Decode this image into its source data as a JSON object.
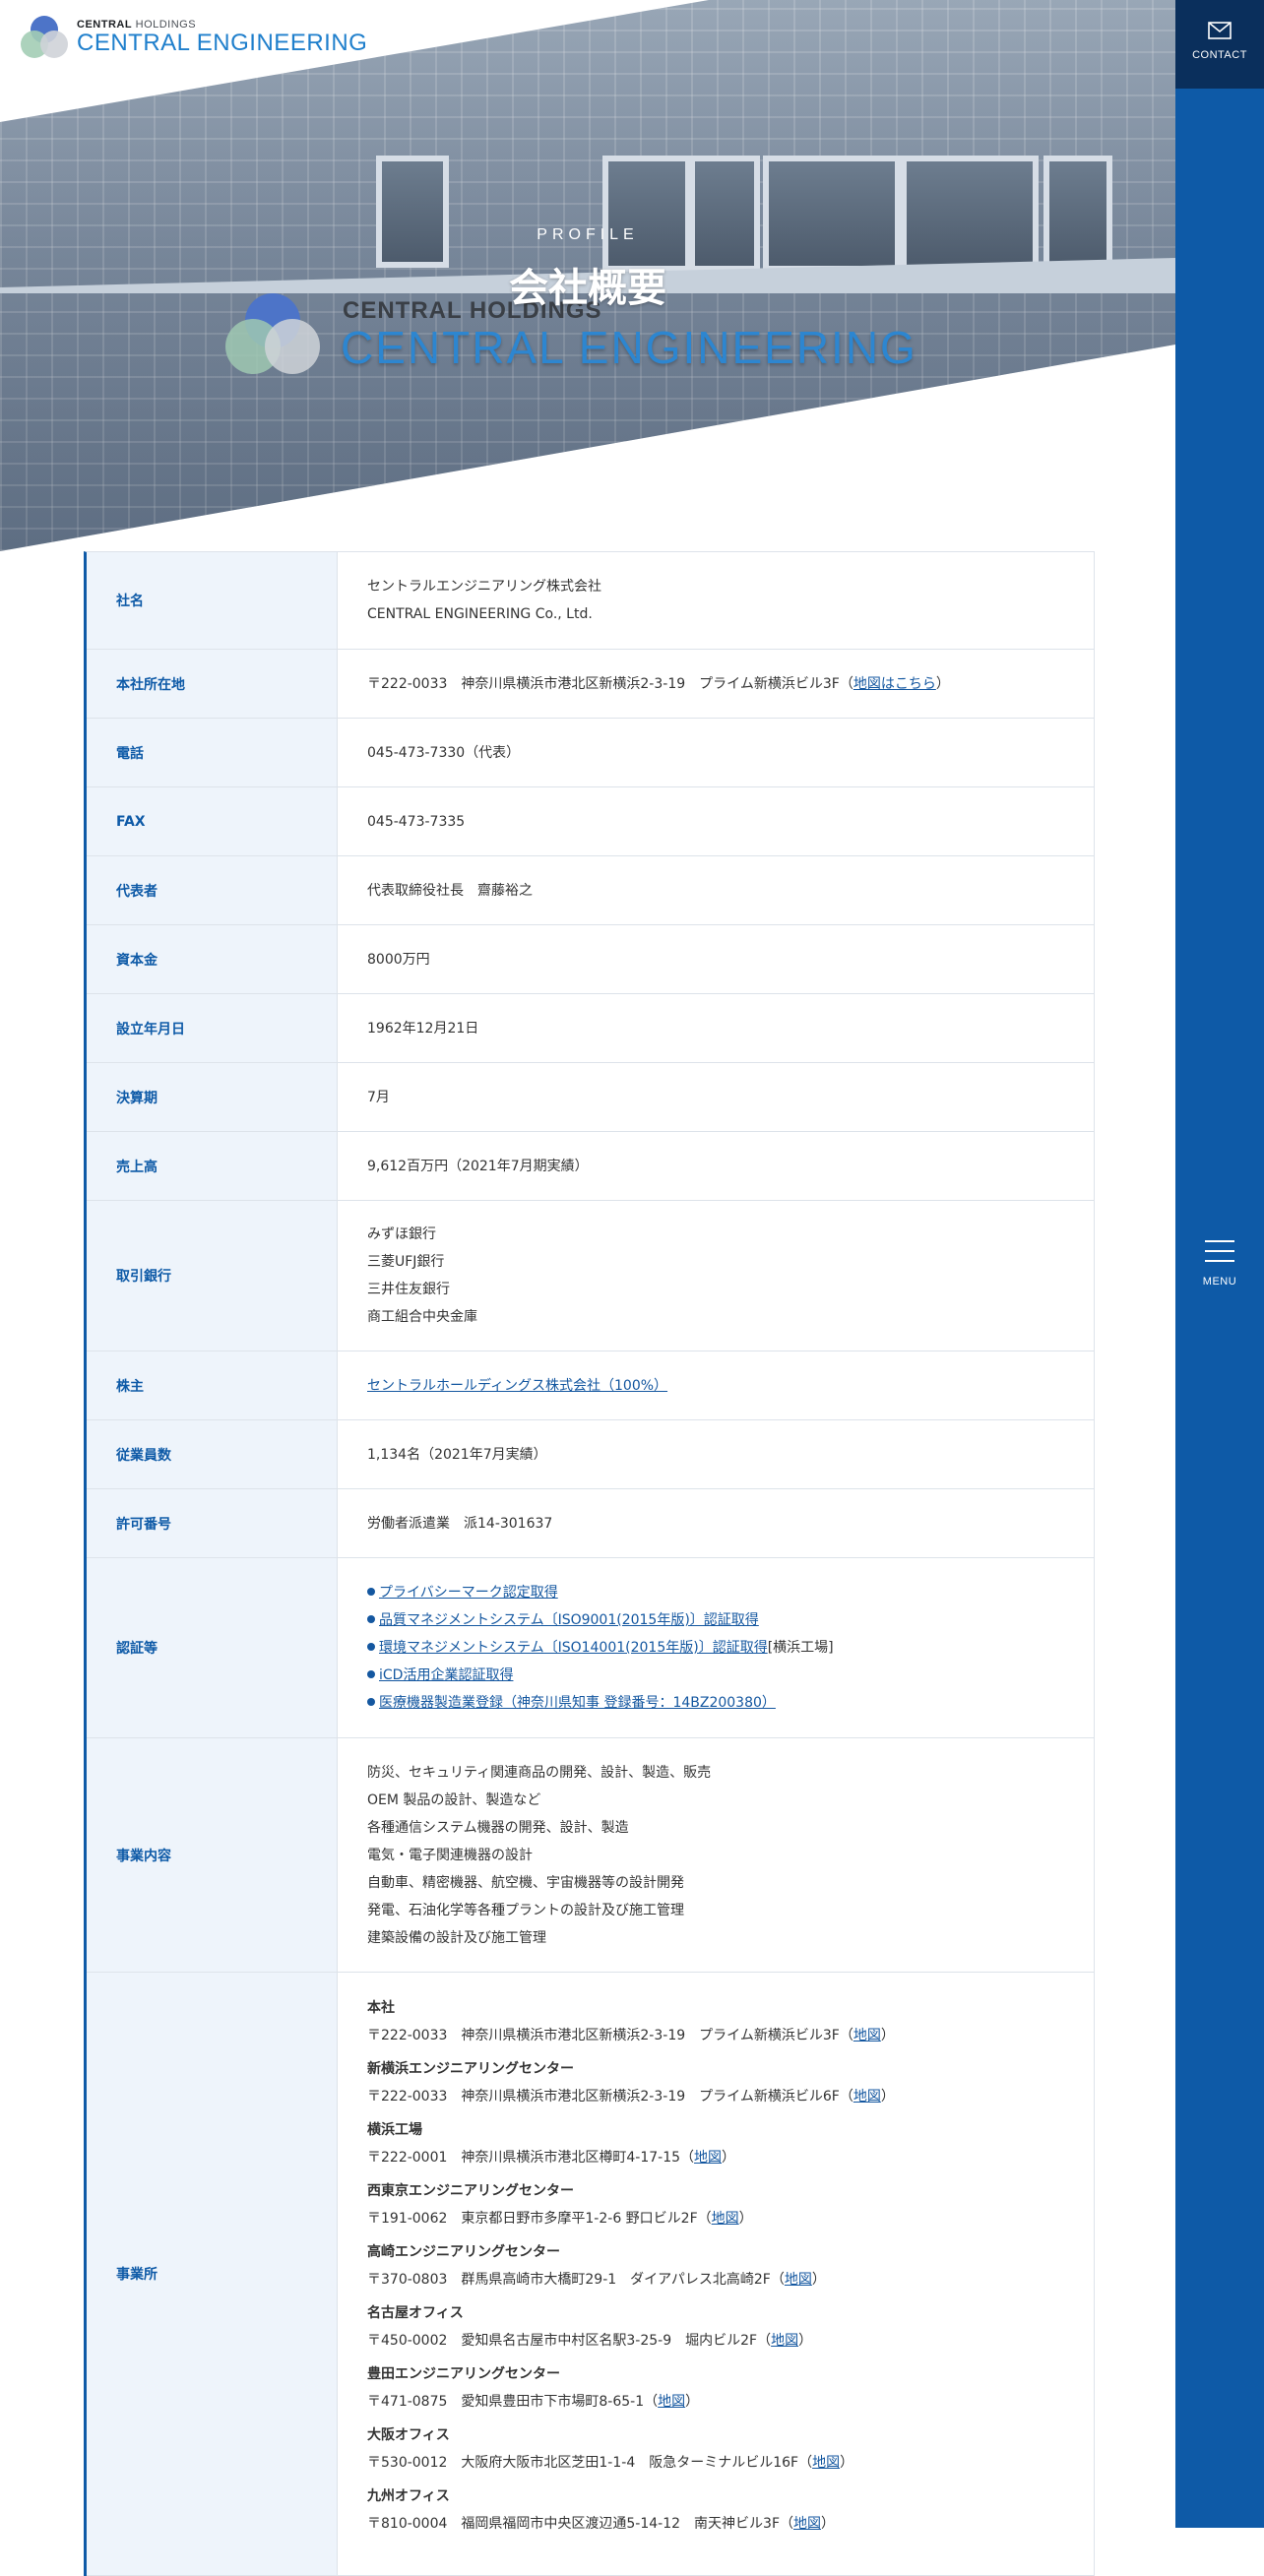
{
  "header": {
    "logo_holdings_bold": "CENTRAL",
    "logo_holdings_rest": " HOLDINGS",
    "logo_name": "CENTRAL ENGINEERING"
  },
  "hero": {
    "eyebrow": "PROFILE",
    "title": "会社概要",
    "sign_holdings": "CENTRAL HOLDINGS",
    "sign_title": "CENTRAL ENGINEERING"
  },
  "sidebar": {
    "contact_label": "CONTACT",
    "menu_label": "MENU"
  },
  "profile": {
    "company_name": {
      "label": "社名",
      "lines": [
        "セントラルエンジニアリング株式会社",
        "CENTRAL ENGINEERING Co., Ltd."
      ]
    },
    "headquarters": {
      "label": "本社所在地",
      "text": "〒222-0033　神奈川県横浜市港北区新横浜2-3-19　プライム新横浜ビル3F（",
      "link": "地図はこちら",
      "close": "）"
    },
    "tel": {
      "label": "電話",
      "text": "045-473-7330（代表）"
    },
    "fax": {
      "label": "FAX",
      "text": "045-473-7335"
    },
    "representative": {
      "label": "代表者",
      "text": "代表取締役社長　齋藤裕之"
    },
    "capital": {
      "label": "資本金",
      "text": "8000万円"
    },
    "established": {
      "label": "設立年月日",
      "text": "1962年12月21日"
    },
    "fiscal": {
      "label": "決算期",
      "text": "7月"
    },
    "sales": {
      "label": "売上高",
      "text": "9,612百万円（2021年7月期実績）"
    },
    "banks": {
      "label": "取引銀行",
      "lines": [
        "みずほ銀行",
        "三菱UFJ銀行",
        "三井住友銀行",
        "商工組合中央金庫"
      ]
    },
    "shareholder": {
      "label": "株主",
      "link": "セントラルホールディングス株式会社（100%）"
    },
    "employees": {
      "label": "従業員数",
      "text": "1,134名（2021年7月実績）"
    },
    "license": {
      "label": "許可番号",
      "text": "労働者派遣業　派14-301637"
    },
    "certifications": {
      "label": "認証等",
      "items": [
        {
          "link": "プライバシーマーク認定取得",
          "suffix": ""
        },
        {
          "link": "品質マネジメントシステム〔ISO9001(2015年版)〕認証取得",
          "suffix": ""
        },
        {
          "link": "環境マネジメントシステム〔ISO14001(2015年版)〕認証取得",
          "suffix": "[横浜工場]"
        },
        {
          "link": "iCD活用企業認証取得",
          "suffix": ""
        },
        {
          "link": "医療機器製造業登録（神奈川県知事 登録番号：14BZ200380）",
          "suffix": ""
        }
      ]
    },
    "business": {
      "label": "事業内容",
      "lines": [
        "防災、セキュリティ関連商品の開発、設計、製造、販売",
        "OEM 製品の設計、製造など",
        "各種通信システム機器の開発、設計、製造",
        "電気・電子関連機器の設計",
        "自動車、精密機器、航空機、宇宙機器等の設計開発",
        "発電、石油化学等各種プラントの設計及び施工管理",
        "建築設備の設計及び施工管理"
      ]
    },
    "offices": {
      "label": "事業所",
      "map_label": "地図",
      "items": [
        {
          "name": "本社",
          "address": "〒222-0033　神奈川県横浜市港北区新横浜2-3-19　プライム新横浜ビル3F（"
        },
        {
          "name": "新横浜エンジニアリングセンター",
          "address": "〒222-0033　神奈川県横浜市港北区新横浜2-3-19　プライム新横浜ビル6F（"
        },
        {
          "name": "横浜工場",
          "address": "〒222-0001　神奈川県横浜市港北区樽町4-17-15（"
        },
        {
          "name": "西東京エンジニアリングセンター",
          "address": "〒191-0062　東京都日野市多摩平1-2-6 野口ビル2F（"
        },
        {
          "name": "高崎エンジニアリングセンター",
          "address": "〒370-0803　群馬県高崎市大橋町29-1　ダイアパレス北高崎2F（"
        },
        {
          "name": "名古屋オフィス",
          "address": "〒450-0002　愛知県名古屋市中村区名駅3-25-9　堀内ビル2F（"
        },
        {
          "name": "豊田エンジニアリングセンター",
          "address": "〒471-0875　愛知県豊田市下市場町8-65-1（"
        },
        {
          "name": "大阪オフィス",
          "address": "〒530-0012　大阪府大阪市北区芝田1-1-4　阪急ターミナルビル16F（"
        },
        {
          "name": "九州オフィス",
          "address": "〒810-0004　福岡県福岡市中央区渡辺通5-14-12　南天神ビル3F（"
        }
      ]
    }
  }
}
